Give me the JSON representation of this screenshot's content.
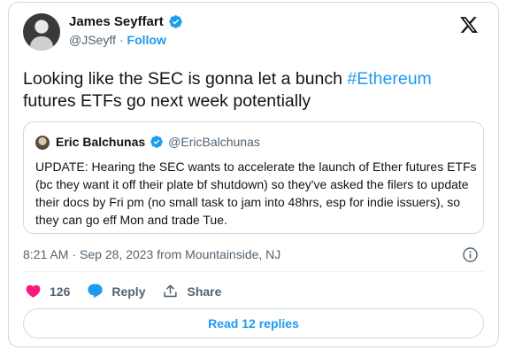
{
  "author": {
    "name": "James Seyffart",
    "handle": "@JSeyff",
    "separator": "·",
    "follow_label": "Follow"
  },
  "tweet": {
    "text_before": "Looking like the SEC is gonna let a bunch ",
    "hashtag": "#Ethereum",
    "text_after": " futures ETFs go next week potentially"
  },
  "quote": {
    "name": "Eric Balchunas",
    "handle": "@EricBalchunas",
    "text": "UPDATE: Hearing the SEC wants to accelerate the launch of Ether futures ETFs (bc they want it off their plate bf shutdown) so they've asked the filers to update their docs by Fri pm (no small task to jam into 48hrs, esp for indie issuers), so they can go eff Mon and trade Tue."
  },
  "meta": {
    "time": "8:21 AM",
    "separator": "·",
    "date_location": "Sep 28, 2023 from Mountainside, NJ"
  },
  "actions": {
    "like_count": "126",
    "reply_label": "Reply",
    "share_label": "Share"
  },
  "read_replies_label": "Read 12 replies",
  "colors": {
    "accent": "#1d9bf0",
    "like": "#f91880",
    "reply": "#1d9bf0",
    "text": "#0f1419",
    "secondary": "#536471",
    "border": "#cfd9de"
  },
  "icons": {
    "verified": "verified-badge-icon",
    "logo": "x-logo-icon",
    "info": "info-icon",
    "like": "heart-icon",
    "reply": "speech-bubble-icon",
    "share": "share-upload-icon"
  }
}
